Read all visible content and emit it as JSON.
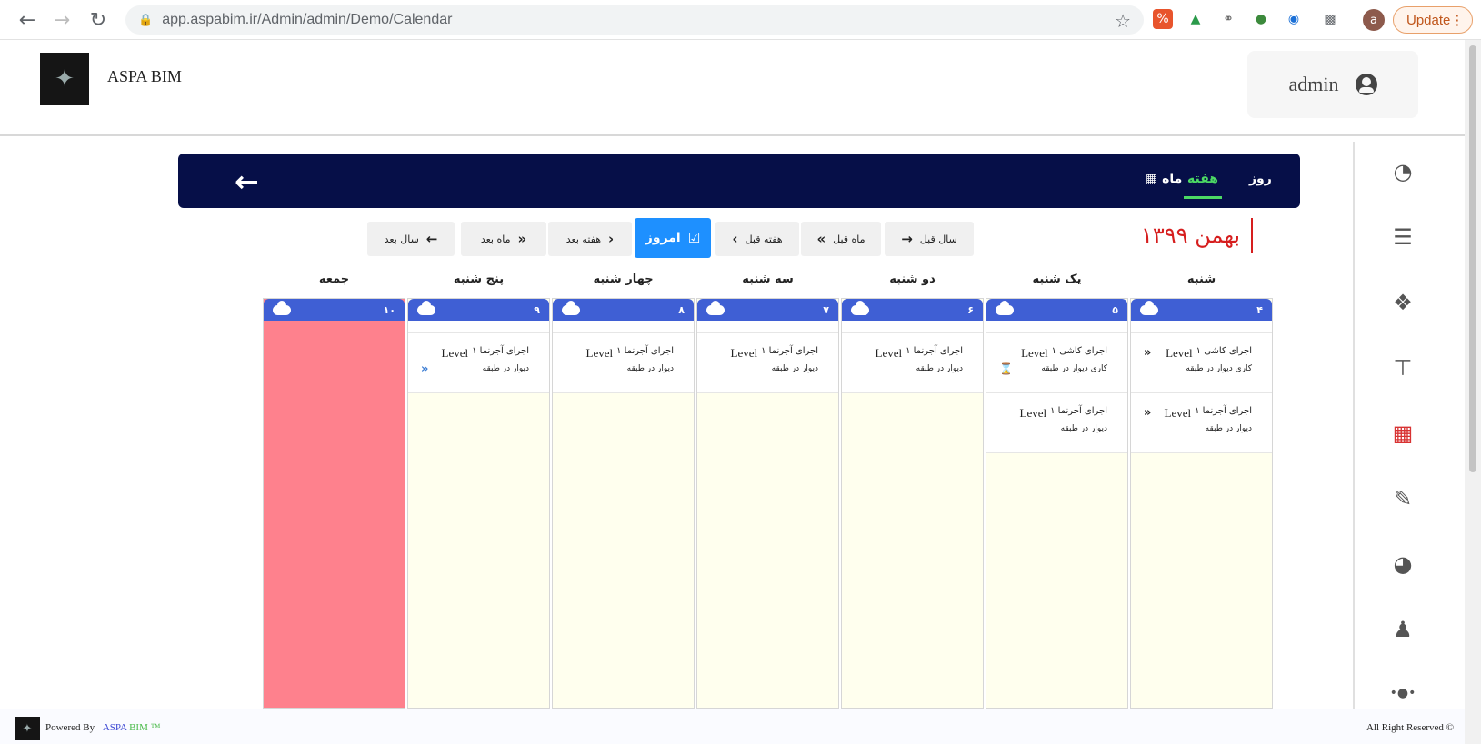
{
  "browser": {
    "url": "app.aspabim.ir/Admin/admin/Demo/Calendar",
    "update_label": "Update"
  },
  "header": {
    "brand": "ASPA BIM",
    "username": "admin"
  },
  "calendar": {
    "views": {
      "day": "روز",
      "week": "هفته",
      "month": "ماه"
    },
    "active_view": "week",
    "month_title": "بهمن ۱۳۹۹",
    "nav": {
      "prev_year": "سال قبل",
      "prev_month": "ماه قبل",
      "prev_week": "هفته قبل",
      "today": "امروز",
      "next_week": "هفته بعد",
      "next_month": "ماه بعد",
      "next_year": "سال بعد"
    },
    "days": [
      {
        "name": "شنبه",
        "date": "۴",
        "holiday": false,
        "events": [
          {
            "title": "اجرای کاشی ۱",
            "level": "Level",
            "subtitle": "کاری دیوار در طبقه",
            "mark": "«",
            "mark_type": "dark"
          },
          {
            "title": "اجرای آجرنما ۱",
            "level": "Level",
            "subtitle": "دیوار در طبقه",
            "mark": "«",
            "mark_type": "dark"
          }
        ]
      },
      {
        "name": "یک شنبه",
        "date": "۵",
        "holiday": false,
        "events": [
          {
            "title": "اجرای کاشی ۱",
            "level": "Level",
            "subtitle": "کاری دیوار در طبقه",
            "mark": "⌛",
            "mark_type": "hour"
          },
          {
            "title": "اجرای آجرنما ۱",
            "level": "Level",
            "subtitle": "دیوار در طبقه",
            "mark": "",
            "mark_type": ""
          }
        ]
      },
      {
        "name": "دو شنبه",
        "date": "۶",
        "holiday": false,
        "events": [
          {
            "title": "اجرای آجرنما ۱",
            "level": "Level",
            "subtitle": "دیوار در طبقه",
            "mark": "",
            "mark_type": ""
          }
        ]
      },
      {
        "name": "سه شنبه",
        "date": "۷",
        "holiday": false,
        "events": [
          {
            "title": "اجرای آجرنما ۱",
            "level": "Level",
            "subtitle": "دیوار در طبقه",
            "mark": "",
            "mark_type": ""
          }
        ]
      },
      {
        "name": "چهار شنبه",
        "date": "۸",
        "holiday": false,
        "events": [
          {
            "title": "اجرای آجرنما ۱",
            "level": "Level",
            "subtitle": "دیوار در طبقه",
            "mark": "",
            "mark_type": ""
          }
        ]
      },
      {
        "name": "پنج شنبه",
        "date": "۹",
        "holiday": false,
        "events": [
          {
            "title": "اجرای آجرنما ۱",
            "level": "Level",
            "subtitle": "دیوار در طبقه",
            "mark": "«",
            "mark_type": "blue"
          }
        ]
      },
      {
        "name": "جمعه",
        "date": "۱۰",
        "holiday": true,
        "events": []
      }
    ]
  },
  "footer": {
    "powered_by": "Powered By",
    "brand_a": "ASPA",
    "brand_b": "BIM ™",
    "rights": "All Right Reserved ©"
  },
  "colors": {
    "bar_bg": "#060f48",
    "active_tab": "#4cd964",
    "day_header": "#3f5fd4",
    "holiday": "#fe818d",
    "cell_bg": "#ffffee",
    "today_btn": "#1e90ff",
    "month_title": "#d61e1e"
  }
}
